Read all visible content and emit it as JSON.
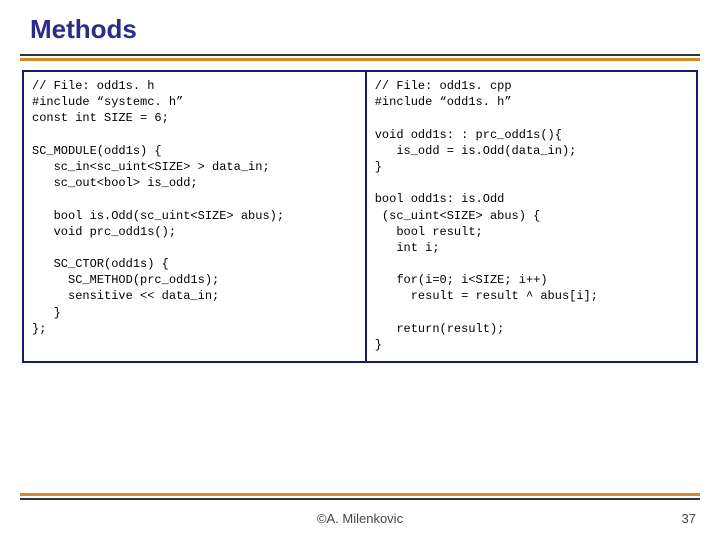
{
  "title": "Methods",
  "code_left": "// File: odd1s. h\n#include “systemc. h”\nconst int SIZE = 6;\n\nSC_MODULE(odd1s) {\n   sc_in<sc_uint<SIZE> > data_in;\n   sc_out<bool> is_odd;\n\n   bool is.Odd(sc_uint<SIZE> abus);\n   void prc_odd1s();\n\n   SC_CTOR(odd1s) {\n     SC_METHOD(prc_odd1s);\n     sensitive << data_in;\n   }\n};",
  "code_right": "// File: odd1s. cpp\n#include “odd1s. h”\n\nvoid odd1s: : prc_odd1s(){\n   is_odd = is.Odd(data_in);\n}\n\nbool odd1s: is.Odd\n (sc_uint<SIZE> abus) {\n   bool result;\n   int i;\n\n   for(i=0; i<SIZE; i++)\n     result = result ^ abus[i];\n\n   return(result);\n}",
  "footer": "©A. Milenkovic",
  "page": "37"
}
